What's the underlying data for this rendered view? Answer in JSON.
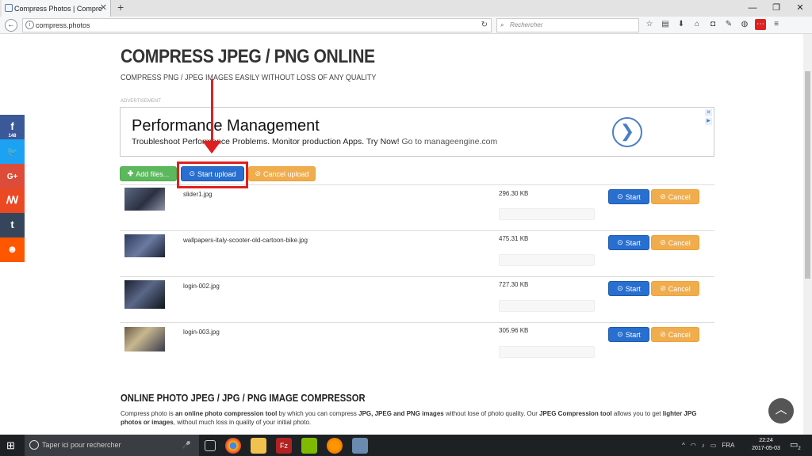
{
  "browser": {
    "tab_title": "Compress Photos | Compre",
    "tab_close": "✕",
    "new_tab": "+",
    "url": "compress.photos",
    "search_placeholder": "Rechercher",
    "window_controls": [
      "—",
      "❐",
      "✕"
    ]
  },
  "page": {
    "title": "COMPRESS JPEG / PNG ONLINE",
    "subtitle": "COMPRESS PNG / JPEG IMAGES EASILY WITHOUT LOSS OF ANY QUALITY",
    "ad_label": "ADVERTISEMENT",
    "ad": {
      "title": "Performance Management",
      "text": "Troubleshoot Performance Problems. Monitor production Apps. Try Now!",
      "sub": "Go to manageengine.com",
      "arrow": "❯"
    }
  },
  "social": [
    {
      "name": "facebook",
      "glyph": "f",
      "color": "#3b5998",
      "count": "148"
    },
    {
      "name": "twitter",
      "glyph": "🐦",
      "color": "#1da1f2"
    },
    {
      "name": "google-plus",
      "glyph": "G+",
      "color": "#dd4b39"
    },
    {
      "name": "stumbleupon",
      "glyph": "ꟿ",
      "color": "#eb4924"
    },
    {
      "name": "tumblr",
      "glyph": "t",
      "color": "#35465c"
    },
    {
      "name": "reddit",
      "glyph": "☻",
      "color": "#ff5700"
    }
  ],
  "toolbar": {
    "add_files": "Add files...",
    "start_upload": "Start upload",
    "cancel_upload": "Cancel upload"
  },
  "files": [
    {
      "name": "slider1.jpg",
      "size": "296.30 KB"
    },
    {
      "name": "wallpapers-italy-scooter-old-cartoon-bike.jpg",
      "size": "475.31 KB"
    },
    {
      "name": "login-002.jpg",
      "size": "727.30 KB"
    },
    {
      "name": "login-003.jpg",
      "size": "305.96 KB"
    }
  ],
  "row_actions": {
    "start": "Start",
    "cancel": "Cancel"
  },
  "section2": {
    "title": "ONLINE PHOTO JPEG / JPG / PNG IMAGE COMPRESSOR",
    "text_before": "Compress photo is",
    "bold1": "an online photo compression tool",
    "text_mid1": "by which you can compress",
    "bold2": "JPG, JPEG and PNG images",
    "text_mid2": "without lose of photo quality. Our",
    "bold3": "JPEG Compression tool",
    "text_mid3": "allows you to get",
    "bold4": "lighter JPG photos or images",
    "text_after": ", without much loss in quality of your initial photo."
  },
  "taskbar": {
    "search_placeholder": "Taper ici pour rechercher",
    "lang": "FRA",
    "time": "22:24",
    "date": "2017-05-03",
    "notif_count": "2"
  },
  "colors": {
    "green": "#5cb85c",
    "blue": "#286fd0",
    "orange": "#f0ad4e",
    "annotation_red": "#e02020"
  }
}
